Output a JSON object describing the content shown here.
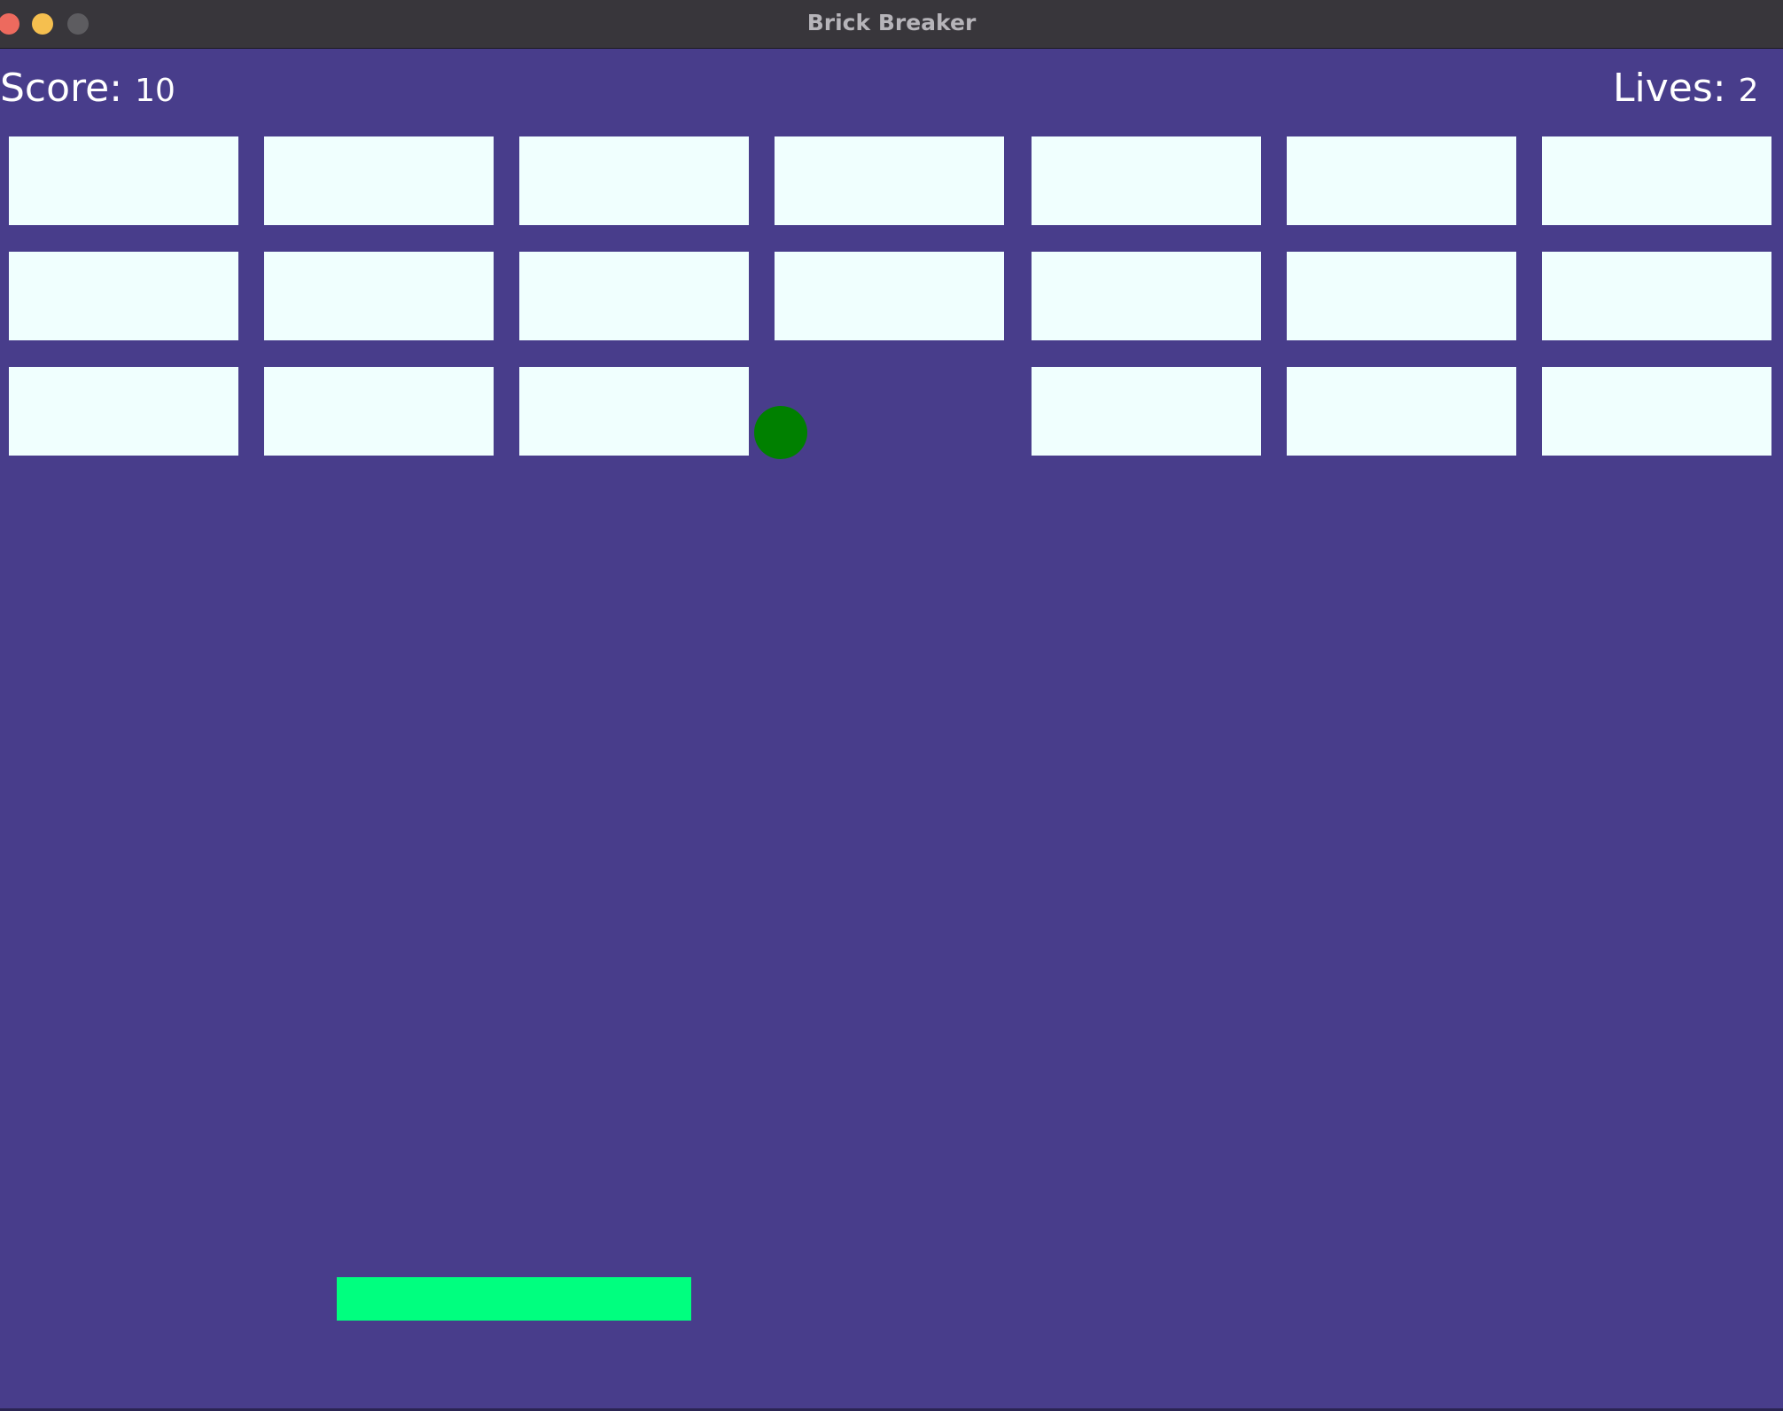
{
  "window": {
    "title": "Brick Breaker"
  },
  "hud": {
    "score_label": "Score:",
    "score_value": "10",
    "lives_label": "Lives:",
    "lives_value": "2"
  },
  "colors": {
    "background": "#483d8b",
    "brick": "#f0fffe",
    "ball": "#008000",
    "paddle": "#00ff7f"
  },
  "bricks": {
    "rows": 3,
    "columns": 7,
    "present": [
      [
        true,
        true,
        true,
        true,
        true,
        true,
        true
      ],
      [
        true,
        true,
        true,
        true,
        true,
        true,
        true
      ],
      [
        true,
        true,
        true,
        false,
        true,
        true,
        true
      ]
    ]
  },
  "ball": {
    "color": "#008000"
  },
  "paddle": {
    "color": "#00ff7f"
  }
}
